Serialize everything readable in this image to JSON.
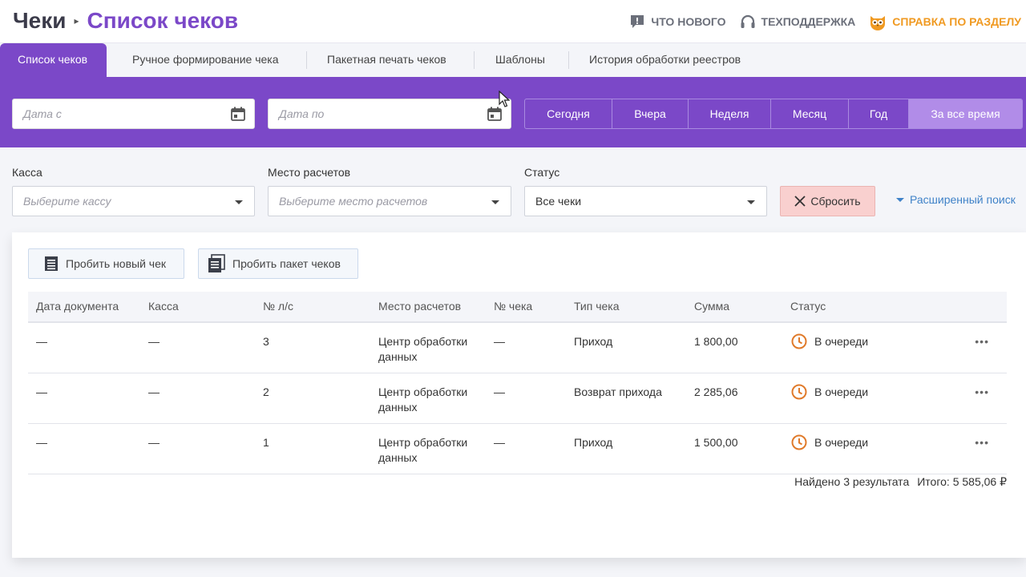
{
  "breadcrumb": {
    "root": "Чеки",
    "separator": "▸",
    "current": "Список чеков"
  },
  "top_links": [
    {
      "label": "Что нового",
      "icon": "news-icon"
    },
    {
      "label": "Техподдержка",
      "icon": "headset-icon"
    },
    {
      "label": "Справка по разделу",
      "icon": "owl-icon"
    }
  ],
  "tabs": [
    {
      "label": "Список чеков",
      "active": true
    },
    {
      "label": "Ручное формирование чека"
    },
    {
      "label": "Пакетная печать чеков"
    },
    {
      "label": "Шаблоны"
    },
    {
      "label": "История обработки реестров"
    }
  ],
  "date_filter": {
    "from_placeholder": "Дата с",
    "to_placeholder": "Дата по",
    "periods": [
      "Сегодня",
      "Вчера",
      "Неделя",
      "Месяц",
      "Год",
      "За все время"
    ],
    "active_period": "За все время"
  },
  "filters": {
    "kassa": {
      "label": "Касса",
      "placeholder": "Выберите кассу"
    },
    "place": {
      "label": "Место расчетов",
      "placeholder": "Выберите место расчетов"
    },
    "status": {
      "label": "Статус",
      "value": "Все чеки"
    },
    "reset_label": "Сбросить",
    "advanced_label": "Расширенный поиск"
  },
  "actions": {
    "new_receipt": "Пробить новый чек",
    "batch_receipt": "Пробить пакет чеков"
  },
  "table": {
    "columns": [
      "Дата документа",
      "Касса",
      "№ л/с",
      "Место расчетов",
      "№ чека",
      "Тип чека",
      "Сумма",
      "Статус"
    ],
    "rows": [
      {
        "date": "—",
        "kassa": "—",
        "ls": "3",
        "place_1": "Центр обработки",
        "place_2": "данных",
        "num": "—",
        "type": "Приход",
        "sum": "1 800,00",
        "status": "В очереди",
        "menu": "•••"
      },
      {
        "date": "—",
        "kassa": "—",
        "ls": "2",
        "place_1": "Центр обработки",
        "place_2": "данных",
        "num": "—",
        "type": "Возврат прихода",
        "sum": "2 285,06",
        "status": "В очереди",
        "menu": "•••"
      },
      {
        "date": "—",
        "kassa": "—",
        "ls": "1",
        "place_1": "Центр обработки",
        "place_2": "данных",
        "num": "—",
        "type": "Приход",
        "sum": "1 500,00",
        "status": "В очереди",
        "menu": "•••"
      }
    ]
  },
  "summary": {
    "found": "Найдено 3 результата",
    "total": "Итого: 5 585,06 ₽"
  },
  "colors": {
    "accent": "#7b48c8",
    "accent_light": "#b18ce8",
    "orange": "#f09a22",
    "status_orange": "#e07a2a",
    "reset_bg": "#f9d0cf",
    "link": "#3f82c8"
  }
}
